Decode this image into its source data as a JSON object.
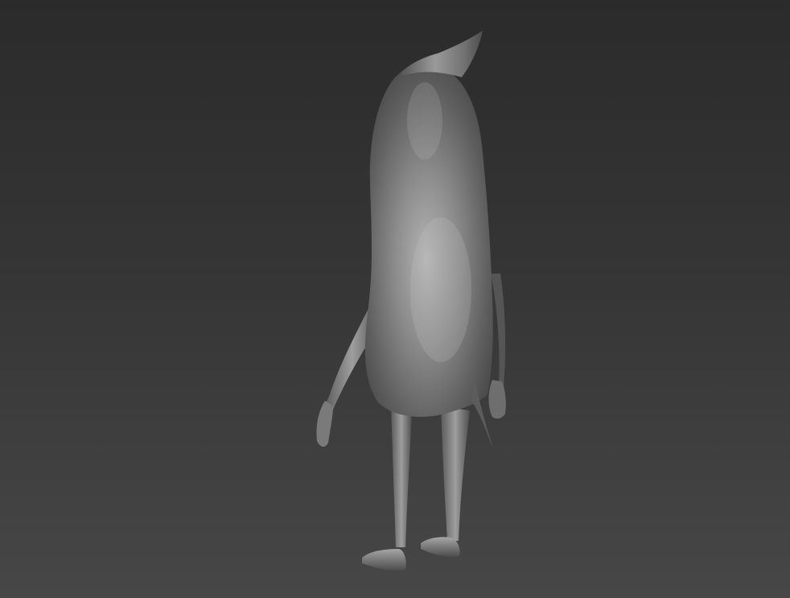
{
  "viewport": {
    "background_top": "#2b2b2b",
    "background_bottom": "#474747",
    "shading_mode": "clay",
    "model_color": "#8a8a8a",
    "model_highlight": "#b8b8b8",
    "model_shadow": "#3c3c3c"
  },
  "model": {
    "icon": "creature-model-icon"
  }
}
